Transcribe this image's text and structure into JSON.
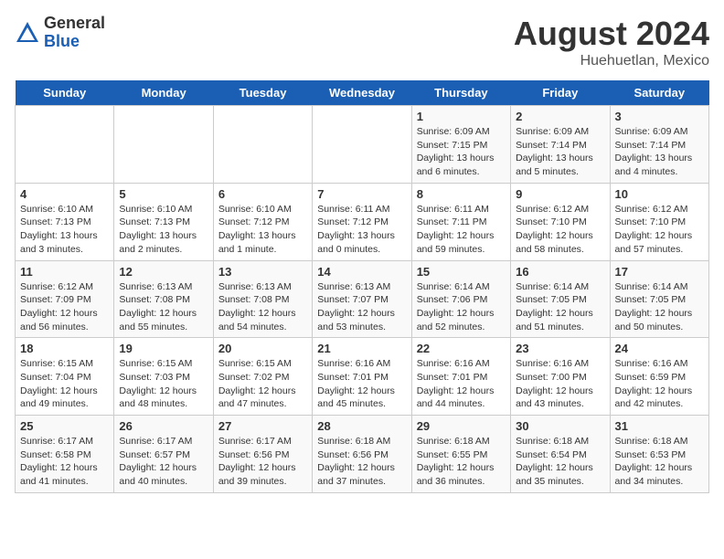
{
  "logo": {
    "general": "General",
    "blue": "Blue"
  },
  "title": "August 2024",
  "subtitle": "Huehuetlan, Mexico",
  "days_of_week": [
    "Sunday",
    "Monday",
    "Tuesday",
    "Wednesday",
    "Thursday",
    "Friday",
    "Saturday"
  ],
  "weeks": [
    [
      {
        "day": "",
        "info": ""
      },
      {
        "day": "",
        "info": ""
      },
      {
        "day": "",
        "info": ""
      },
      {
        "day": "",
        "info": ""
      },
      {
        "day": "1",
        "info": "Sunrise: 6:09 AM\nSunset: 7:15 PM\nDaylight: 13 hours\nand 6 minutes."
      },
      {
        "day": "2",
        "info": "Sunrise: 6:09 AM\nSunset: 7:14 PM\nDaylight: 13 hours\nand 5 minutes."
      },
      {
        "day": "3",
        "info": "Sunrise: 6:09 AM\nSunset: 7:14 PM\nDaylight: 13 hours\nand 4 minutes."
      }
    ],
    [
      {
        "day": "4",
        "info": "Sunrise: 6:10 AM\nSunset: 7:13 PM\nDaylight: 13 hours\nand 3 minutes."
      },
      {
        "day": "5",
        "info": "Sunrise: 6:10 AM\nSunset: 7:13 PM\nDaylight: 13 hours\nand 2 minutes."
      },
      {
        "day": "6",
        "info": "Sunrise: 6:10 AM\nSunset: 7:12 PM\nDaylight: 13 hours\nand 1 minute."
      },
      {
        "day": "7",
        "info": "Sunrise: 6:11 AM\nSunset: 7:12 PM\nDaylight: 13 hours\nand 0 minutes."
      },
      {
        "day": "8",
        "info": "Sunrise: 6:11 AM\nSunset: 7:11 PM\nDaylight: 12 hours\nand 59 minutes."
      },
      {
        "day": "9",
        "info": "Sunrise: 6:12 AM\nSunset: 7:10 PM\nDaylight: 12 hours\nand 58 minutes."
      },
      {
        "day": "10",
        "info": "Sunrise: 6:12 AM\nSunset: 7:10 PM\nDaylight: 12 hours\nand 57 minutes."
      }
    ],
    [
      {
        "day": "11",
        "info": "Sunrise: 6:12 AM\nSunset: 7:09 PM\nDaylight: 12 hours\nand 56 minutes."
      },
      {
        "day": "12",
        "info": "Sunrise: 6:13 AM\nSunset: 7:08 PM\nDaylight: 12 hours\nand 55 minutes."
      },
      {
        "day": "13",
        "info": "Sunrise: 6:13 AM\nSunset: 7:08 PM\nDaylight: 12 hours\nand 54 minutes."
      },
      {
        "day": "14",
        "info": "Sunrise: 6:13 AM\nSunset: 7:07 PM\nDaylight: 12 hours\nand 53 minutes."
      },
      {
        "day": "15",
        "info": "Sunrise: 6:14 AM\nSunset: 7:06 PM\nDaylight: 12 hours\nand 52 minutes."
      },
      {
        "day": "16",
        "info": "Sunrise: 6:14 AM\nSunset: 7:05 PM\nDaylight: 12 hours\nand 51 minutes."
      },
      {
        "day": "17",
        "info": "Sunrise: 6:14 AM\nSunset: 7:05 PM\nDaylight: 12 hours\nand 50 minutes."
      }
    ],
    [
      {
        "day": "18",
        "info": "Sunrise: 6:15 AM\nSunset: 7:04 PM\nDaylight: 12 hours\nand 49 minutes."
      },
      {
        "day": "19",
        "info": "Sunrise: 6:15 AM\nSunset: 7:03 PM\nDaylight: 12 hours\nand 48 minutes."
      },
      {
        "day": "20",
        "info": "Sunrise: 6:15 AM\nSunset: 7:02 PM\nDaylight: 12 hours\nand 47 minutes."
      },
      {
        "day": "21",
        "info": "Sunrise: 6:16 AM\nSunset: 7:01 PM\nDaylight: 12 hours\nand 45 minutes."
      },
      {
        "day": "22",
        "info": "Sunrise: 6:16 AM\nSunset: 7:01 PM\nDaylight: 12 hours\nand 44 minutes."
      },
      {
        "day": "23",
        "info": "Sunrise: 6:16 AM\nSunset: 7:00 PM\nDaylight: 12 hours\nand 43 minutes."
      },
      {
        "day": "24",
        "info": "Sunrise: 6:16 AM\nSunset: 6:59 PM\nDaylight: 12 hours\nand 42 minutes."
      }
    ],
    [
      {
        "day": "25",
        "info": "Sunrise: 6:17 AM\nSunset: 6:58 PM\nDaylight: 12 hours\nand 41 minutes."
      },
      {
        "day": "26",
        "info": "Sunrise: 6:17 AM\nSunset: 6:57 PM\nDaylight: 12 hours\nand 40 minutes."
      },
      {
        "day": "27",
        "info": "Sunrise: 6:17 AM\nSunset: 6:56 PM\nDaylight: 12 hours\nand 39 minutes."
      },
      {
        "day": "28",
        "info": "Sunrise: 6:18 AM\nSunset: 6:56 PM\nDaylight: 12 hours\nand 37 minutes."
      },
      {
        "day": "29",
        "info": "Sunrise: 6:18 AM\nSunset: 6:55 PM\nDaylight: 12 hours\nand 36 minutes."
      },
      {
        "day": "30",
        "info": "Sunrise: 6:18 AM\nSunset: 6:54 PM\nDaylight: 12 hours\nand 35 minutes."
      },
      {
        "day": "31",
        "info": "Sunrise: 6:18 AM\nSunset: 6:53 PM\nDaylight: 12 hours\nand 34 minutes."
      }
    ]
  ]
}
